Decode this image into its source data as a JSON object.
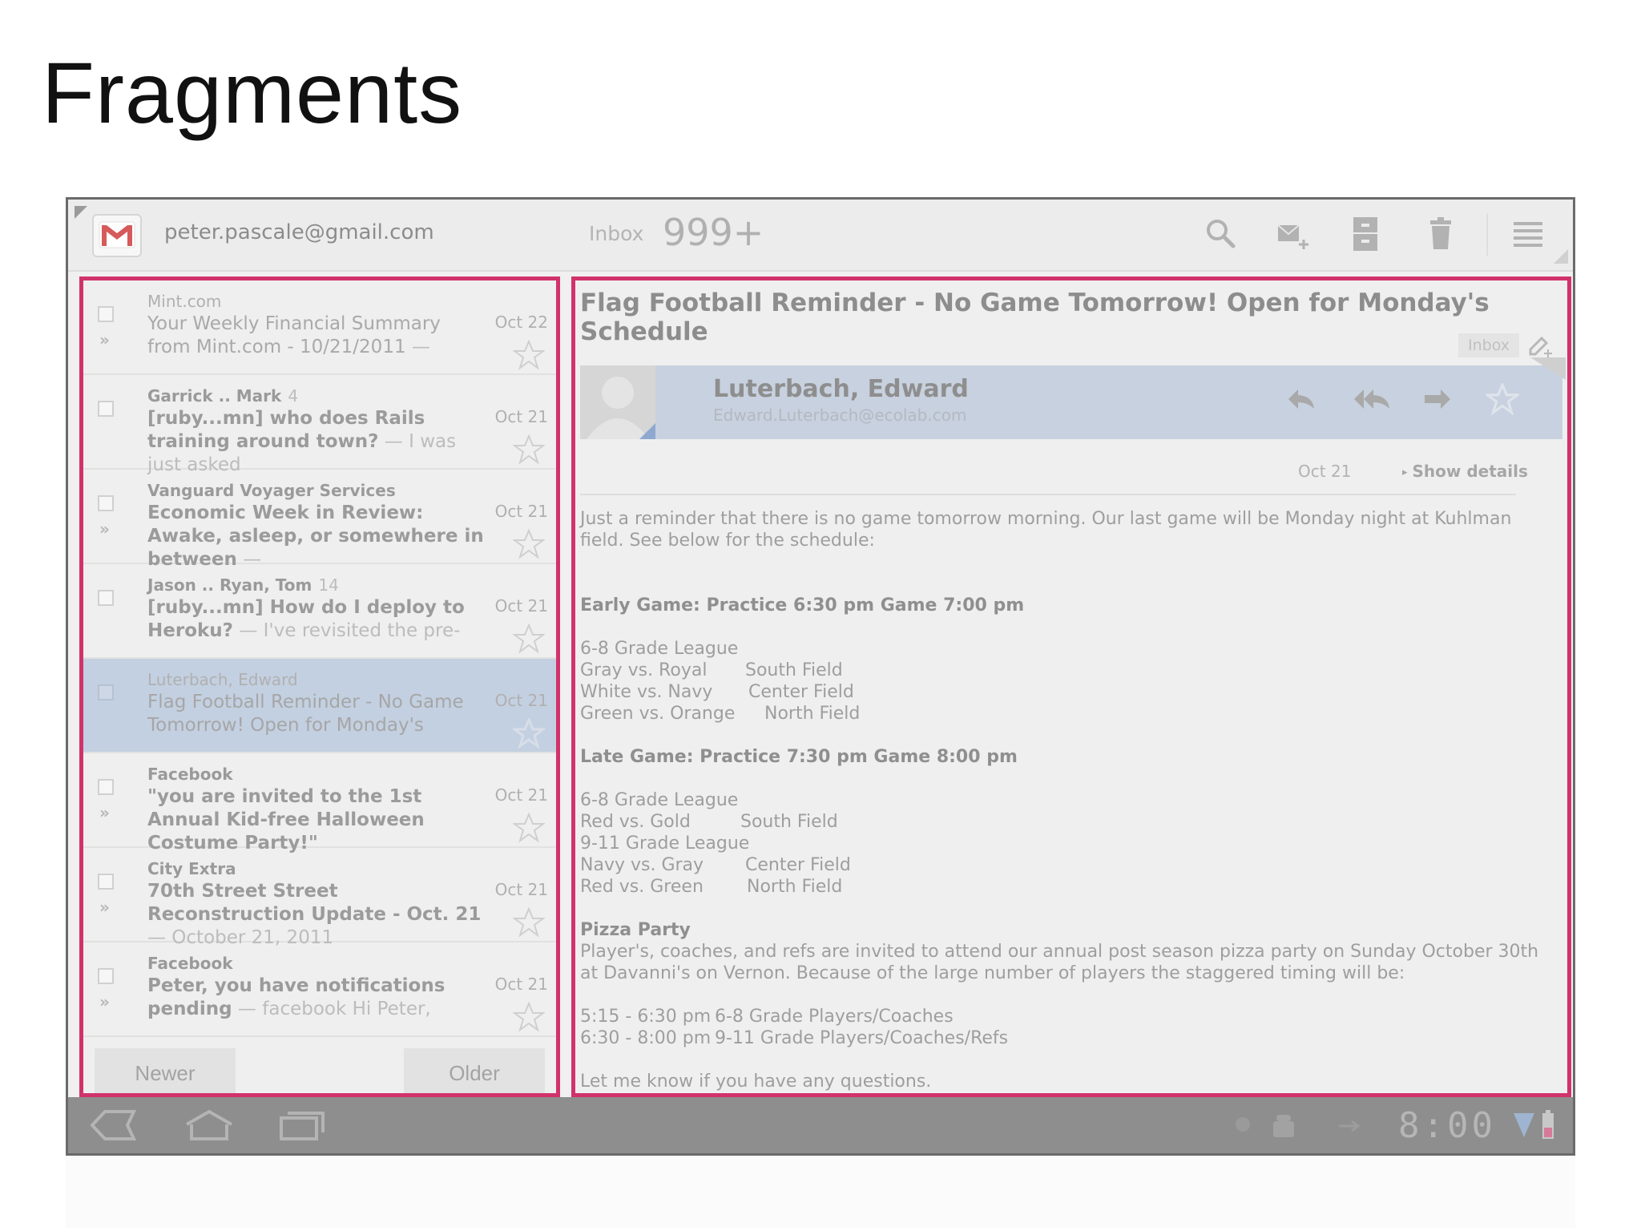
{
  "slide": {
    "title": "Fragments"
  },
  "actionbar": {
    "account": "peter.pascale@gmail.com",
    "inbox_label": "Inbox",
    "inbox_count": "999+",
    "icons": [
      "search-icon",
      "compose-icon",
      "archive-icon",
      "trash-icon",
      "overflow-menu-icon"
    ]
  },
  "conversations": [
    {
      "sender": "Mint.com",
      "count": "",
      "subject": "Your Weekly Financial Summary from Mint.com - 10/21/2011",
      "snippet": " — ",
      "date": "Oct 22",
      "double_arrow": "»",
      "style": "light"
    },
    {
      "sender": "Garrick .. Mark",
      "count": "4",
      "subject": "[ruby...mn] who does Rails training around town?",
      "snippet": " — I was just asked",
      "date": "Oct 21",
      "double_arrow": "",
      "style": "bold"
    },
    {
      "sender": "Vanguard Voyager Services",
      "count": "",
      "subject": "Economic Week in Review: Awake, asleep, or somewhere in between",
      "snippet": " — ",
      "date": "Oct 21",
      "double_arrow": "»",
      "style": "bold"
    },
    {
      "sender": "Jason .. Ryan, Tom",
      "count": "14",
      "subject": "[ruby...mn] How do I deploy to Heroku?",
      "snippet": " — I've revisited the pre-",
      "date": "Oct 21",
      "double_arrow": "",
      "style": "bold"
    },
    {
      "sender": "Luterbach, Edward",
      "count": "",
      "subject": "Flag Football Reminder - No Game Tomorrow! Open for Monday's",
      "snippet": "",
      "date": "Oct 21",
      "double_arrow": "",
      "style": "read"
    },
    {
      "sender": "Facebook",
      "count": "",
      "subject": "\"you are invited to the 1st Annual Kid-free Halloween Costume Party!\"",
      "snippet": "",
      "date": "Oct 21",
      "double_arrow": "»",
      "style": "bold"
    },
    {
      "sender": "City Extra",
      "count": "",
      "subject": "70th Street Street Reconstruction Update - Oct. 21",
      "snippet": " — October 21, 2011",
      "date": "Oct 21",
      "double_arrow": "»",
      "style": "bold"
    },
    {
      "sender": "Facebook",
      "count": "",
      "subject": "Peter, you have notifications pending",
      "snippet": " — facebook Hi Peter,",
      "date": "Oct 21",
      "double_arrow": "»",
      "style": "bold"
    }
  ],
  "list_buttons": {
    "newer": "Newer",
    "older": "Older"
  },
  "thread": {
    "subject": "Flag Football Reminder - No Game Tomorrow! Open for Monday's Schedule",
    "label": "Inbox",
    "from_name": "Luterbach, Edward",
    "from_email": "Edward.Luterbach@ecolab.com",
    "date": "Oct 21",
    "show_details": "Show details",
    "body": {
      "intro": "Just a reminder that there is no game tomorrow morning. Our last game will be Monday night at Kuhlman field. See below for the schedule:",
      "early_heading": "Early Game: Practice 6:30 pm Game 7:00 pm",
      "early_league": "6-8 Grade League",
      "early_games": [
        {
          "match": "Gray vs. Royal",
          "field": "South Field"
        },
        {
          "match": "White vs. Navy",
          "field": "Center Field"
        },
        {
          "match": "Green vs. Orange",
          "field": "North Field"
        }
      ],
      "late_heading": "Late Game: Practice 7:30 pm Game 8:00 pm",
      "late_league_1": "6-8 Grade League",
      "late_games_1": [
        {
          "match": "Red vs. Gold",
          "field": "South Field"
        }
      ],
      "late_league_2": "9-11 Grade League",
      "late_games_2": [
        {
          "match": "Navy vs. Gray",
          "field": "Center Field"
        },
        {
          "match": "Red vs. Green",
          "field": "North Field"
        }
      ],
      "pizza_heading": "Pizza Party",
      "pizza_text": "Player's, coaches, and refs are invited to attend our annual post season pizza party on Sunday October 30th at Davanni's on Vernon. Because of the large number of players the staggered timing will be:",
      "times": [
        {
          "time": "5:15 - 6:30 pm",
          "who": "6-8 Grade Players/Coaches"
        },
        {
          "time": "6:30 - 8:00 pm",
          "who": "9-11 Grade Players/Coaches/Refs"
        }
      ],
      "closing": "Let me know if you have any questions."
    }
  },
  "system_bar": {
    "clock": "8:00"
  },
  "colors": {
    "highlight_border": "#d1326b",
    "selected_row": "#c3d0e1",
    "gmail_red": "#d44638"
  }
}
